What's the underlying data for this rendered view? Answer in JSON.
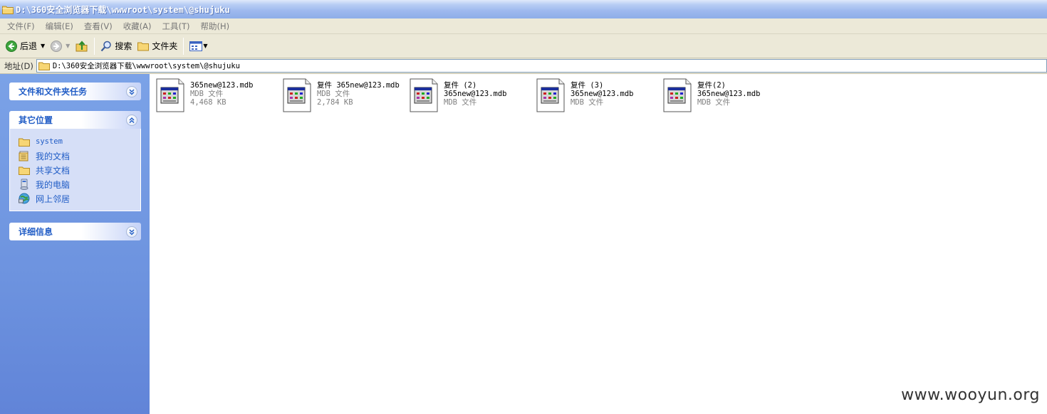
{
  "window": {
    "title": "D:\\360安全浏览器下载\\wwwroot\\system\\@shujuku"
  },
  "menu": {
    "items": [
      "文件(F)",
      "编辑(E)",
      "查看(V)",
      "收藏(A)",
      "工具(T)",
      "帮助(H)"
    ]
  },
  "toolbar": {
    "back_label": "后退",
    "search_label": "搜索",
    "folders_label": "文件夹"
  },
  "address": {
    "label": "地址(D)",
    "value": "D:\\360安全浏览器下载\\wwwroot\\system\\@shujuku"
  },
  "taskpane": {
    "tasks_title": "文件和文件夹任务",
    "places_title": "其它位置",
    "places": [
      {
        "label": "system",
        "icon": "folder-icon"
      },
      {
        "label": "我的文档",
        "icon": "documents-icon"
      },
      {
        "label": "共享文档",
        "icon": "folder-icon"
      },
      {
        "label": "我的电脑",
        "icon": "computer-icon"
      },
      {
        "label": "网上邻居",
        "icon": "network-icon"
      }
    ],
    "details_title": "详细信息"
  },
  "files": [
    {
      "line1": "365new@123.mdb",
      "line2": "",
      "type": "MDB 文件",
      "size": "4,468 KB"
    },
    {
      "line1": "复件 365new@123.mdb",
      "line2": "",
      "type": "MDB 文件",
      "size": "2,784 KB"
    },
    {
      "line1": "复件 (2)",
      "line2": "365new@123.mdb",
      "type": "MDB 文件",
      "size": ""
    },
    {
      "line1": "复件 (3)",
      "line2": "365new@123.mdb",
      "type": "MDB 文件",
      "size": ""
    },
    {
      "line1": "复件(2)",
      "line2": "365new@123.mdb",
      "type": "MDB 文件",
      "size": ""
    }
  ],
  "watermark": "www.wooyun.org",
  "colors": {
    "taskpane_bg": "#6d93df",
    "link_blue": "#215dc6",
    "menubar_bg": "#ece9d8"
  }
}
